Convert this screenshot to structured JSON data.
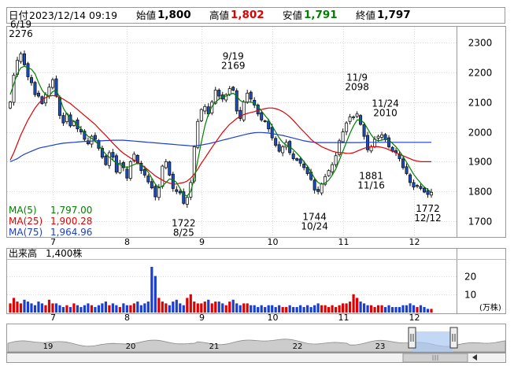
{
  "header": {
    "date_label": "日付",
    "date_value": "2023/12/14 09:19",
    "open_label": "始値",
    "open_value": "1,800",
    "high_label": "高値",
    "high_value": "1,802",
    "low_label": "安値",
    "low_value": "1,791",
    "close_label": "終値",
    "close_value": "1,797"
  },
  "legend": {
    "ma5": "MA(5)",
    "ma5_value": "1,797.00",
    "ma25": "MA(25)",
    "ma25_value": "1,900.28",
    "ma75": "MA(75)",
    "ma75_value": "1,964.96"
  },
  "volume_label": "出来高",
  "volume_value": "1,400株",
  "volume_unit": "(万株)",
  "colors": {
    "up": "#ffffff",
    "down": "#1a4fc8",
    "ma5": "#008000",
    "ma25": "#e00000",
    "ma75": "#1a3fd0",
    "vol_up": "#e00000",
    "vol_down": "#1a3fd0"
  },
  "chart_data": [
    {
      "type": "candlestick",
      "ylim": [
        1650,
        2350
      ],
      "yticks": [
        1700,
        1800,
        1900,
        2000,
        2100,
        2200,
        2300
      ],
      "month_labels": [
        {
          "label": "7",
          "index": 12
        },
        {
          "label": "8",
          "index": 33
        },
        {
          "label": "9",
          "index": 54
        },
        {
          "label": "10",
          "index": 74
        },
        {
          "label": "11",
          "index": 94
        },
        {
          "label": "12",
          "index": 114
        }
      ],
      "annotations": [
        {
          "text": [
            "6/19",
            "2276"
          ],
          "index": 3,
          "value": 2276,
          "pos": "above"
        },
        {
          "text": [
            "9/19",
            "2169"
          ],
          "index": 63,
          "value": 2169,
          "pos": "above"
        },
        {
          "text": [
            "11/9",
            "2098"
          ],
          "index": 98,
          "value": 2098,
          "pos": "above"
        },
        {
          "text": [
            "11/24",
            "2010"
          ],
          "index": 106,
          "value": 2010,
          "pos": "above"
        },
        {
          "text": [
            "1722",
            "8/25"
          ],
          "index": 49,
          "value": 1722,
          "pos": "below"
        },
        {
          "text": [
            "1744",
            "10/24"
          ],
          "index": 86,
          "value": 1744,
          "pos": "below"
        },
        {
          "text": [
            "1881",
            "11/16"
          ],
          "index": 102,
          "value": 1881,
          "pos": "below"
        },
        {
          "text": [
            "1772",
            "12/12"
          ],
          "index": 118,
          "value": 1772,
          "pos": "below"
        }
      ],
      "close": [
        2100,
        2190,
        2240,
        2262,
        2225,
        2185,
        2165,
        2125,
        2120,
        2095,
        2125,
        2150,
        2175,
        2120,
        2055,
        2030,
        2060,
        2020,
        2035,
        2010,
        2000,
        1975,
        1960,
        1985,
        1975,
        1945,
        1915,
        1890,
        1930,
        1915,
        1865,
        1895,
        1880,
        1845,
        1900,
        1925,
        1895,
        1870,
        1855,
        1832,
        1812,
        1782,
        1815,
        1885,
        1900,
        1855,
        1810,
        1800,
        1795,
        1760,
        1780,
        1830,
        1950,
        2035,
        2075,
        2085,
        2060,
        2100,
        2140,
        2120,
        2110,
        2125,
        2145,
        2140,
        2070,
        2045,
        2100,
        2130,
        2110,
        2090,
        2060,
        2040,
        2035,
        2010,
        1980,
        1955,
        1935,
        1950,
        1965,
        1930,
        1910,
        1905,
        1895,
        1880,
        1860,
        1840,
        1805,
        1800,
        1825,
        1850,
        1870,
        1890,
        1920,
        1970,
        2000,
        2030,
        2050,
        2050,
        2060,
        2025,
        1985,
        1940,
        1950,
        1975,
        1985,
        1990,
        1975,
        1950,
        1935,
        1930,
        1910,
        1880,
        1860,
        1830,
        1815,
        1820,
        1810,
        1798,
        1790,
        1797
      ],
      "ma5": [
        2125,
        2160,
        2195,
        2215,
        2220,
        2215,
        2210,
        2195,
        2165,
        2140,
        2125,
        2120,
        2135,
        2140,
        2115,
        2080,
        2060,
        2045,
        2035,
        2025,
        2010,
        1998,
        1985,
        1978,
        1970,
        1955,
        1940,
        1925,
        1915,
        1905,
        1895,
        1890,
        1885,
        1880,
        1885,
        1890,
        1895,
        1890,
        1880,
        1865,
        1845,
        1825,
        1812,
        1818,
        1830,
        1842,
        1840,
        1830,
        1810,
        1790,
        1785,
        1800,
        1845,
        1905,
        1965,
        2020,
        2060,
        2085,
        2100,
        2110,
        2118,
        2120,
        2125,
        2130,
        2120,
        2105,
        2100,
        2100,
        2100,
        2095,
        2085,
        2070,
        2055,
        2040,
        2020,
        2000,
        1980,
        1965,
        1955,
        1950,
        1940,
        1928,
        1915,
        1900,
        1885,
        1865,
        1845,
        1830,
        1825,
        1828,
        1838,
        1855,
        1875,
        1905,
        1935,
        1965,
        1995,
        2020,
        2040,
        2040,
        2030,
        2010,
        1990,
        1975,
        1970,
        1972,
        1975,
        1972,
        1962,
        1950,
        1935,
        1918,
        1898,
        1878,
        1858,
        1842,
        1828,
        1815,
        1806,
        1797
      ],
      "ma25": [
        1905,
        1930,
        1960,
        1990,
        2015,
        2040,
        2060,
        2080,
        2095,
        2108,
        2115,
        2120,
        2122,
        2120,
        2115,
        2110,
        2102,
        2095,
        2085,
        2075,
        2065,
        2055,
        2045,
        2035,
        2025,
        2012,
        2000,
        1988,
        1975,
        1962,
        1950,
        1938,
        1928,
        1920,
        1912,
        1905,
        1898,
        1890,
        1882,
        1872,
        1862,
        1852,
        1845,
        1838,
        1832,
        1828,
        1825,
        1825,
        1828,
        1830,
        1835,
        1845,
        1858,
        1875,
        1895,
        1912,
        1930,
        1948,
        1965,
        1982,
        1998,
        2012,
        2025,
        2035,
        2045,
        2052,
        2058,
        2062,
        2065,
        2068,
        2072,
        2075,
        2078,
        2080,
        2080,
        2078,
        2074,
        2068,
        2060,
        2050,
        2038,
        2025,
        2012,
        2000,
        1988,
        1975,
        1965,
        1958,
        1950,
        1945,
        1940,
        1935,
        1932,
        1930,
        1930,
        1928,
        1928,
        1930,
        1935,
        1940,
        1945,
        1948,
        1950,
        1950,
        1950,
        1948,
        1945,
        1940,
        1935,
        1930,
        1925,
        1920,
        1915,
        1910,
        1905,
        1902,
        1900,
        1900,
        1900,
        1900
      ],
      "ma75": [
        1900,
        1905,
        1910,
        1918,
        1925,
        1930,
        1935,
        1940,
        1945,
        1948,
        1950,
        1953,
        1955,
        1958,
        1960,
        1962,
        1963,
        1964,
        1965,
        1966,
        1967,
        1968,
        1968,
        1969,
        1970,
        1970,
        1970,
        1971,
        1971,
        1972,
        1972,
        1972,
        1972,
        1971,
        1970,
        1969,
        1968,
        1967,
        1966,
        1965,
        1964,
        1963,
        1962,
        1961,
        1960,
        1959,
        1958,
        1957,
        1956,
        1955,
        1954,
        1953,
        1953,
        1954,
        1956,
        1958,
        1960,
        1963,
        1966,
        1969,
        1972,
        1975,
        1978,
        1981,
        1984,
        1987,
        1990,
        1993,
        1995,
        1997,
        1998,
        1998,
        1997,
        1996,
        1994,
        1992,
        1990,
        1988,
        1985,
        1982,
        1979,
        1976,
        1973,
        1970,
        1968,
        1966,
        1965,
        1964,
        1964,
        1964,
        1964,
        1964,
        1964,
        1964,
        1964,
        1964,
        1964,
        1964,
        1964,
        1964,
        1965,
        1965,
        1965,
        1965,
        1965,
        1965,
        1965,
        1965,
        1965,
        1965,
        1965,
        1965,
        1965,
        1965,
        1965,
        1965,
        1965,
        1965,
        1965,
        1965
      ]
    },
    {
      "type": "bar",
      "ylim": [
        0,
        28
      ],
      "yticks": [
        10,
        20
      ],
      "values": [
        5,
        8,
        6,
        5,
        7,
        6,
        5,
        4,
        6,
        5,
        4,
        7,
        5,
        5,
        4,
        3,
        4,
        3,
        5,
        4,
        3,
        4,
        5,
        4,
        3,
        4,
        5,
        6,
        4,
        5,
        4,
        3,
        5,
        4,
        4,
        5,
        6,
        4,
        5,
        6,
        25,
        20,
        8,
        6,
        5,
        4,
        6,
        7,
        5,
        4,
        8,
        10,
        6,
        5,
        5,
        6,
        7,
        5,
        6,
        6,
        5,
        4,
        6,
        7,
        5,
        4,
        5,
        5,
        4,
        4,
        3,
        4,
        3,
        4,
        4,
        3,
        4,
        3,
        3,
        4,
        3,
        3,
        4,
        3,
        4,
        3,
        4,
        5,
        4,
        4,
        3,
        4,
        3,
        4,
        5,
        5,
        6,
        10,
        8,
        6,
        5,
        4,
        4,
        3,
        4,
        4,
        3,
        4,
        3,
        3,
        3,
        4,
        4,
        5,
        4,
        3,
        4,
        3,
        2,
        2
      ]
    }
  ],
  "navigator": {
    "labels": [
      "19",
      "20",
      "21",
      "22",
      "23"
    ]
  }
}
